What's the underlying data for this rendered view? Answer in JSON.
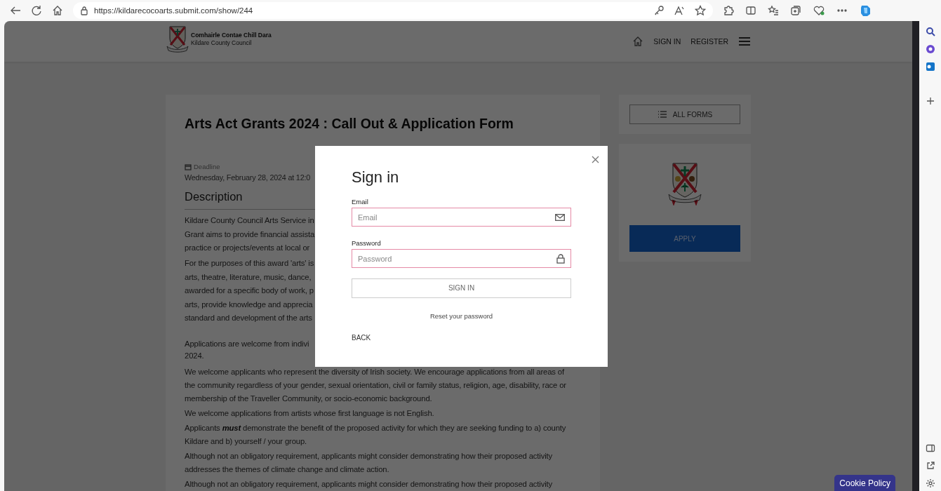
{
  "browser": {
    "url": "https://kildarecocoarts.submit.com/show/244"
  },
  "header": {
    "org_name_irish": "Comhairle Contae Chill Dara",
    "org_name": "Kildare County Council",
    "nav": [
      {
        "label": "SIGN IN"
      },
      {
        "label": "REGISTER"
      }
    ]
  },
  "form_page": {
    "title": "Arts Act Grants 2024 : Call Out & Application Form",
    "deadline_label": "Deadline",
    "deadline_value": "Wednesday, February 28, 2024 at 12:0",
    "section_heading": "Description",
    "paragraphs": [
      {
        "lines": [
          "Kildare County Council Arts Service in",
          "Grant aims to provide financial assista",
          "practice or projects/events at local or"
        ]
      },
      {
        "lines": [
          "For the purposes of this award 'arts' is",
          "arts, theatre, literature, music, dance,",
          "awarded for a specific body of work, p",
          "arts, provide knowledge and apprecia",
          "standard and development of the arts"
        ]
      },
      {
        "lines": [
          "Applications are welcome from indivi",
          "2024."
        ]
      },
      {
        "lines": [
          "We welcome applicants who represent the diversity of Irish society. We encourage applications from all areas of",
          "the community regardless of your gender, sexual orientation, civil or family status, religion, age, disability, race or",
          "membership of the Traveller Community, or socio-economic background."
        ]
      },
      {
        "lines": [
          "We welcome applications from artists whose first language is not English."
        ]
      },
      {
        "lines": [
          "Applicants **must** demonstrate the benefit of the proposed activity for which they are seeking funding to a) county",
          "Kildare and b) yourself / your group."
        ]
      },
      {
        "lines": [
          "Although not an obligatory requirement, applicants might consider demonstrating how their proposed activity",
          "addresses the themes of climate change and climate action."
        ]
      },
      {
        "lines": [
          "Although not an obligatory requirement, applicants might consider demonstrating how their proposed activity"
        ]
      }
    ]
  },
  "sidebar": {
    "all_forms": "ALL FORMS",
    "apply": "APPLY"
  },
  "modal": {
    "title": "Sign in",
    "fields": [
      {
        "kind": "email",
        "label": "Email",
        "placeholder": "Email"
      },
      {
        "kind": "password",
        "label": "Password",
        "placeholder": "Password"
      }
    ],
    "submit": "SIGN IN",
    "reset_link": "Reset your password",
    "back": "BACK"
  },
  "cookie_button": "Cookie Policy"
}
